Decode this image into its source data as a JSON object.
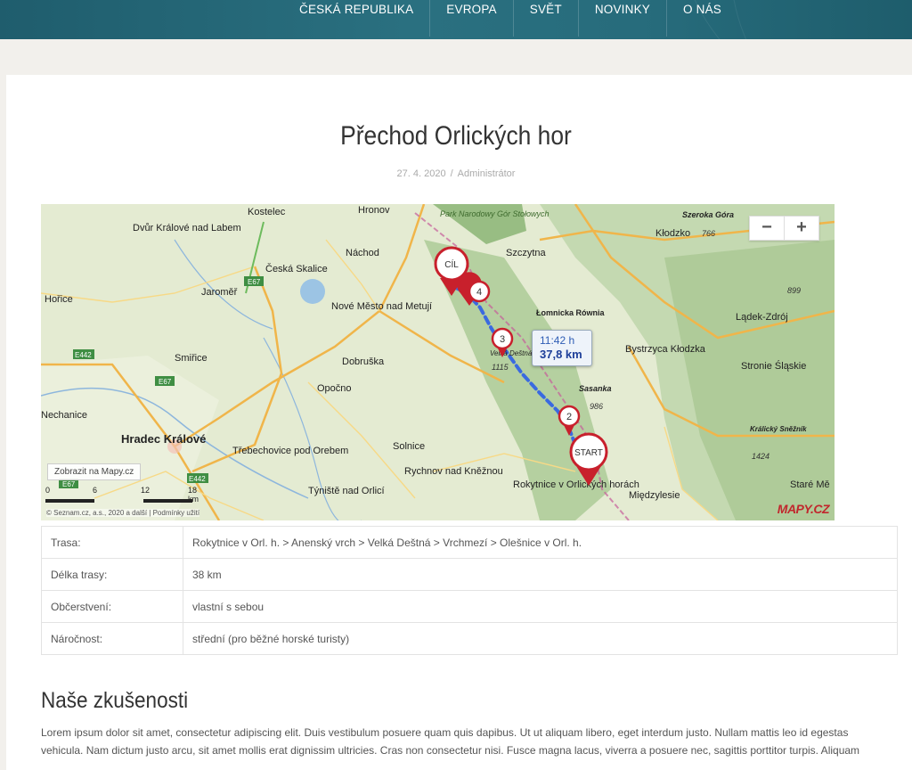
{
  "nav": {
    "items": [
      "ČESKÁ REPUBLIKA",
      "EVROPA",
      "SVĚT",
      "NOVINKY",
      "O NÁS"
    ]
  },
  "article": {
    "title": "Přechod Orlických hor",
    "date": "27. 4. 2020",
    "separator": "/",
    "author": "Administrátor"
  },
  "map": {
    "zoom_out": "−",
    "zoom_in": "+",
    "link_label": "Zobrazit na Mapy.cz",
    "infobox_time": "11:42 h",
    "infobox_distance": "37,8 km",
    "copyright": "© Seznam.cz, a.s., 2020 a další | Podmínky užití",
    "logo": "MAPY.CZ",
    "scale": [
      "0",
      "6",
      "12",
      "18 km"
    ],
    "markers": {
      "start": "START",
      "finish": "CÍL",
      "waypoints": [
        "2",
        "3",
        "4"
      ]
    },
    "places": [
      "Kostelec",
      "Hronov",
      "Dvůr Králové nad Labem",
      "Náchod",
      "Česká Skalice",
      "Nové Město nad Metují",
      "Jaroměř",
      "Hořice",
      "Smiřice",
      "Dobruška",
      "Opočno",
      "Nechanice",
      "Hradec Králové",
      "Třebechovice pod Orebem",
      "Solnice",
      "Rychnov nad Kněžnou",
      "Týniště nad Orlicí",
      "Rokytnice v Orlických horách",
      "Szczytna",
      "Kłodzko",
      "Park Narodowy Gór Stołowych",
      "Łomnicka Równia",
      "Bystrzyca Kłodzka",
      "Lądek-Zdrój",
      "Stronie Śląskie",
      "Sasanka",
      "Międzylesie",
      "Szeroka Góra",
      "Velká Deštná",
      "Králický Sněžník",
      "Staré Mě"
    ],
    "road_labels": [
      "E67",
      "E442",
      "E67",
      "E442",
      "E67"
    ],
    "elevations": [
      "766",
      "899",
      "986",
      "1115",
      "1424"
    ]
  },
  "route_table": [
    {
      "label": "Trasa:",
      "value": "Rokytnice v Orl. h. > Anenský vrch > Velká Deštná > Vrchmezí > Olešnice v Orl. h."
    },
    {
      "label": "Délka trasy:",
      "value": "38 km"
    },
    {
      "label": "Občerstvení:",
      "value": "vlastní s sebou"
    },
    {
      "label": "Náročnost:",
      "value": "střední (pro běžné horské turisty)"
    }
  ],
  "section": {
    "heading": "Naše zkušenosti",
    "paragraph": "Lorem ipsum dolor sit amet, consectetur adipiscing elit. Duis vestibulum posuere quam quis dapibus. Ut ut aliquam libero, eget interdum justo. Nullam mattis leo id egestas vehicula. Nam dictum justo arcu, sit amet mollis erat dignissim ultricies. Cras non consectetur nisi. Fusce magna lacus, viverra a posuere nec, sagittis porttitor turpis. Aliquam"
  },
  "colors": {
    "nav_bg": "#276c7c",
    "route_line": "#3a6ae0",
    "marker_red": "#c8202c"
  }
}
